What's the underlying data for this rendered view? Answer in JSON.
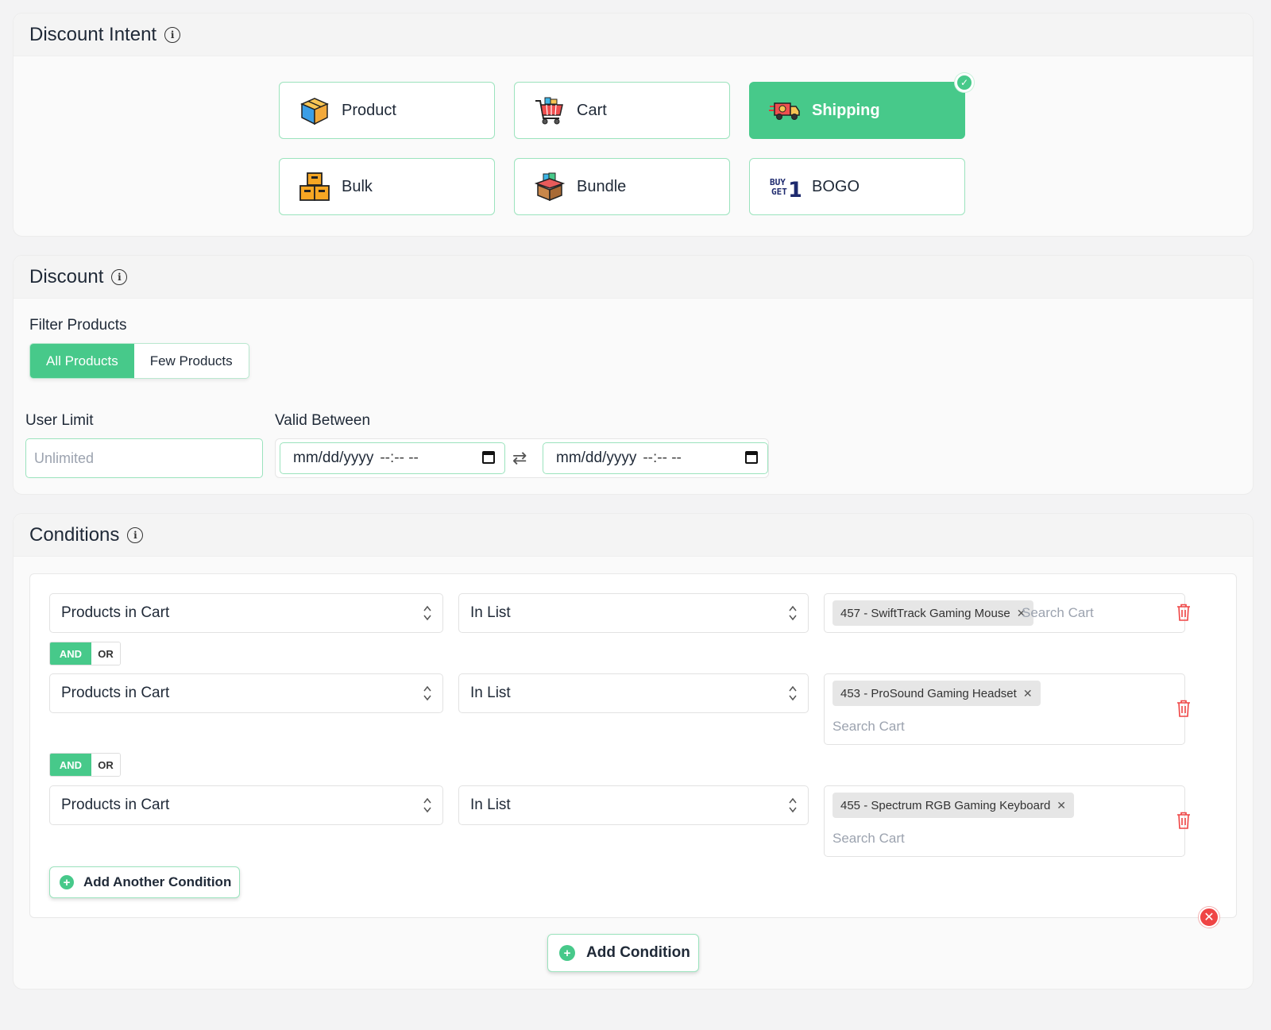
{
  "intent": {
    "title": "Discount Intent",
    "tiles": [
      {
        "label": "Product",
        "icon": "product-box-icon",
        "active": false
      },
      {
        "label": "Cart",
        "icon": "shopping-cart-icon",
        "active": false
      },
      {
        "label": "Shipping",
        "icon": "delivery-truck-icon",
        "active": true
      },
      {
        "label": "Bulk",
        "icon": "stacked-boxes-icon",
        "active": false
      },
      {
        "label": "Bundle",
        "icon": "bundle-box-icon",
        "active": false
      },
      {
        "label": "BOGO",
        "icon": "buy1-get1-icon",
        "active": false
      }
    ],
    "bogo_icon_text": {
      "line1": "BUY",
      "line2": "GET",
      "num": "1"
    }
  },
  "discount": {
    "title": "Discount",
    "filter_label": "Filter Products",
    "filter_options": [
      "All Products",
      "Few Products"
    ],
    "filter_selected": "All Products",
    "user_limit_label": "User Limit",
    "user_limit_placeholder": "Unlimited",
    "valid_between_label": "Valid Between",
    "date_placeholder": "mm/dd/yyyy",
    "time_placeholder": "--:-- --"
  },
  "conditions": {
    "title": "Conditions",
    "rows": [
      {
        "field": "Products in Cart",
        "operator": "In List",
        "tag": "457 - SwiftTrack Gaming Mouse",
        "search_placeholder": "Search Cart"
      },
      {
        "field": "Products in Cart",
        "operator": "In List",
        "tag": "453 - ProSound Gaming Headset",
        "search_placeholder": "Search Cart"
      },
      {
        "field": "Products in Cart",
        "operator": "In List",
        "tag": "455 - Spectrum RGB Gaming Keyboard",
        "search_placeholder": "Search Cart"
      }
    ],
    "connector": {
      "and": "AND",
      "or": "OR"
    },
    "add_another_label": "Add Another Condition",
    "add_condition_label": "Add Condition"
  },
  "colors": {
    "accent": "#47c98a",
    "danger": "#ef4444",
    "border_accent": "#9be3bd"
  }
}
